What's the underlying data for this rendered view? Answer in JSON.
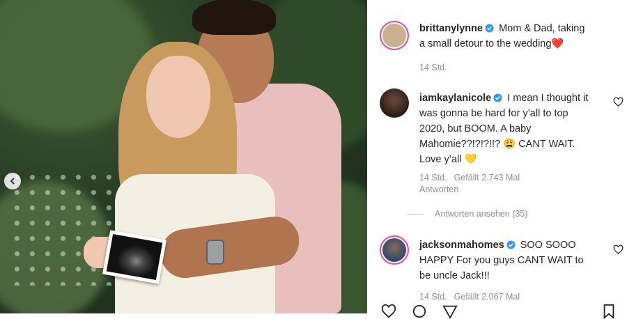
{
  "post": {
    "image_alt": "Couple holding ultrasound photo",
    "carousel_prev_icon": "chevron-left-icon"
  },
  "caption": {
    "username": "brittanylynne",
    "text": "Mom & Dad, taking a small detour to the wedding",
    "emoji": "❤️",
    "time": "14 Std.",
    "avatar_color": "#c9b08f"
  },
  "comments": [
    {
      "username": "iamkaylanicole",
      "text": "I mean I thought it was gonna be hard for y’all to top 2020, but BOOM. A baby Mahomie??!?!?!!?",
      "emoji1": "😩",
      "text2": "CANT WAIT. Love y’all",
      "emoji2": "💛",
      "time": "14 Std.",
      "likes": "Gefällt 2.743 Mal",
      "reply": "Antworten",
      "view_replies": "Antworten ansehen (35)",
      "avatar_color": "#3b2a22"
    },
    {
      "username": "jacksonmahomes",
      "text": "SOO SOOO HAPPY For you guys CANT WAIT to be uncle Jack!!!",
      "time": "14 Std.",
      "likes": "Gefällt 2.067 Mal",
      "avatar_color": "#2e4a6b"
    }
  ],
  "colors": {
    "verified": "#3897f0",
    "meta": "#8e8e8e",
    "story_ring": "#f3449a"
  }
}
